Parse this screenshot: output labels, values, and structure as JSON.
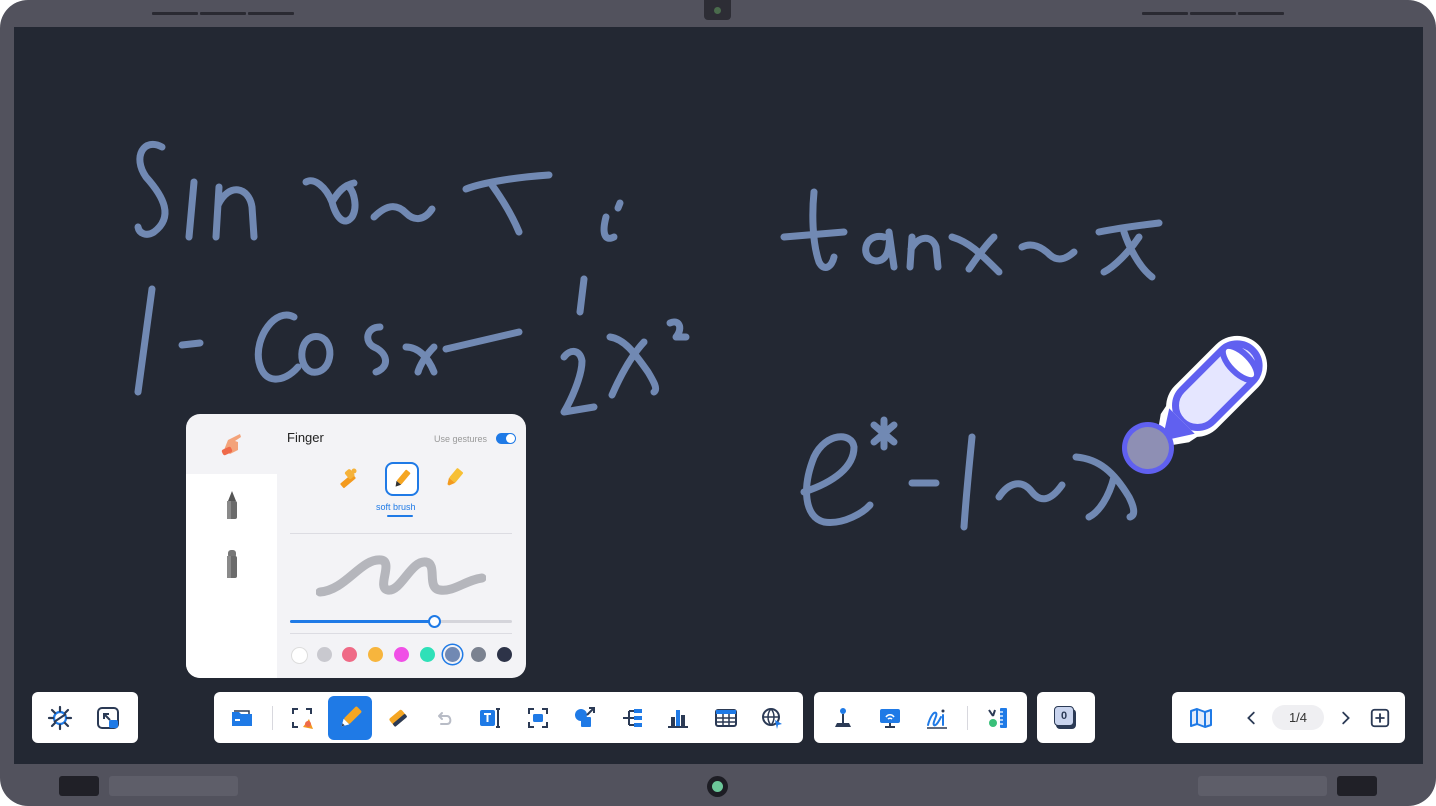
{
  "panel": {
    "title": "Finger",
    "gesture_label": "Use gestures",
    "gesture_enabled": true,
    "brush_selected_label": "soft brush",
    "thickness_fraction": 0.65,
    "colors": [
      {
        "name": "white",
        "hex": "#ffffff"
      },
      {
        "name": "light-gray",
        "hex": "#c9c9cf"
      },
      {
        "name": "pink",
        "hex": "#ef6a86"
      },
      {
        "name": "yellow",
        "hex": "#f7b53d"
      },
      {
        "name": "magenta",
        "hex": "#f050e6"
      },
      {
        "name": "teal",
        "hex": "#2fe0b8"
      },
      {
        "name": "steel-blue",
        "hex": "#7189b3",
        "selected": true
      },
      {
        "name": "gray",
        "hex": "#7b8290"
      },
      {
        "name": "navy",
        "hex": "#2d3348"
      }
    ]
  },
  "pagination": {
    "current": "1/4"
  },
  "counter": {
    "value": "0"
  },
  "colors": {
    "accent": "#1f7ae6",
    "board": "#232833",
    "ink": "#7189b3",
    "bezel": "#52525d"
  },
  "toolbar": {
    "left_tools": [
      "settings-icon",
      "exit-fullscreen-icon"
    ],
    "main_tools": [
      "folder-icon",
      "screenshot-icon",
      "pen-icon",
      "eraser-icon",
      "undo-icon",
      "text-icon",
      "capture-icon",
      "shapes-icon",
      "mindmap-icon",
      "chart-icon",
      "table-icon",
      "browser-icon"
    ],
    "right_tools": [
      "robot-arm-icon",
      "screen-cast-icon",
      "handwriting-icon",
      "tools-icon"
    ]
  }
}
